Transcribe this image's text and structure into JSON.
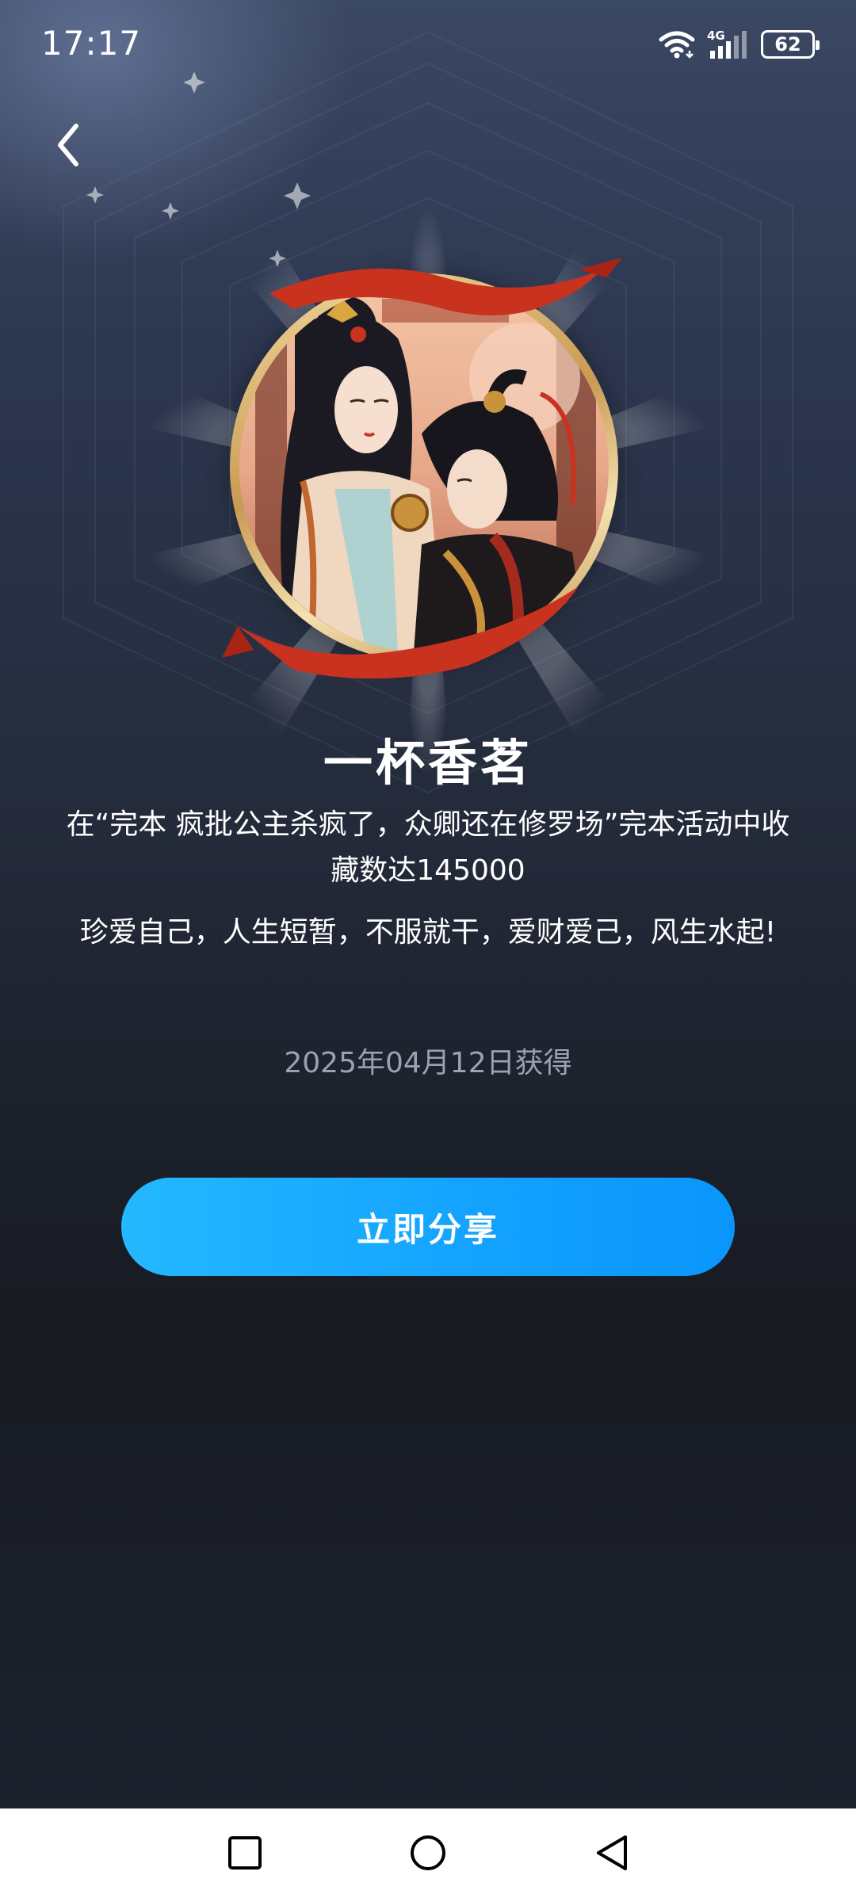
{
  "status_bar": {
    "time": "17:17",
    "network": "4G",
    "battery": "62"
  },
  "icons": {
    "back": "chevron-left-icon",
    "wifi": "wifi-icon",
    "signal": "signal-icon",
    "battery": "battery-icon",
    "nav_recents": "square-icon",
    "nav_home": "circle-icon",
    "nav_back": "triangle-back-icon"
  },
  "badge": {
    "title": "一杯香茗",
    "description": "在“完本 疯批公主杀疯了，众卿还在修罗场”完本活动中收藏数达145000",
    "quote": "珍爱自己，人生短暂，不服就干，爱财爱己，风生水起!",
    "date": "2025年04月12日获得"
  },
  "actions": {
    "share_label": "立即分享"
  },
  "colors": {
    "share_button_start": "#24b8ff",
    "share_button_end": "#0a95fb",
    "background_top": "#3b4863",
    "background_bottom": "#171a21",
    "date_text": "#9aa2b1",
    "ribbon": "#c8321f",
    "medal_gold": "#e3bf7a"
  }
}
